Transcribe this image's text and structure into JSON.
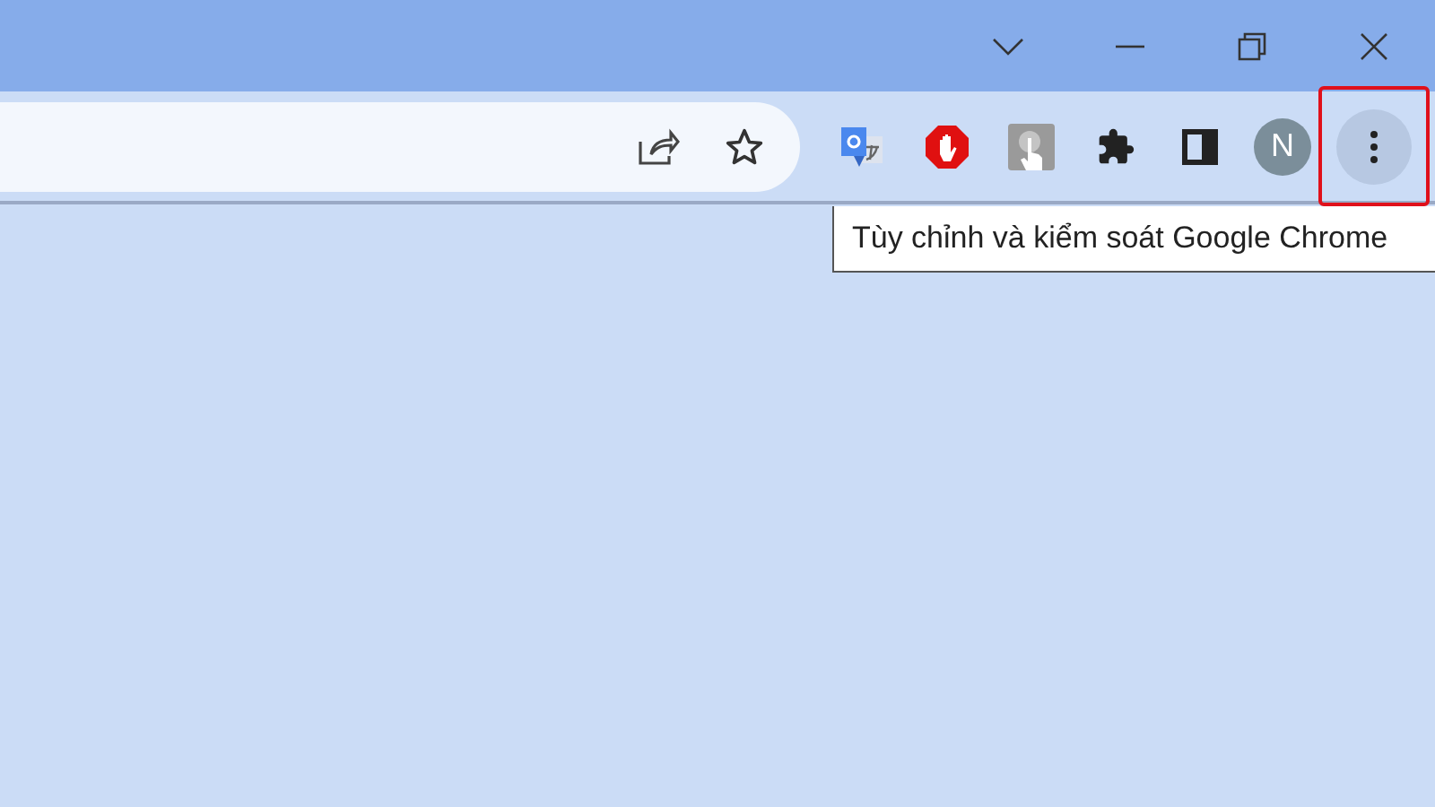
{
  "profile": {
    "initial": "N"
  },
  "menu_button": {
    "hovered": true,
    "highlighted": true
  },
  "tooltip": {
    "text": "Tùy chỉnh và kiểm soát Google Chrome"
  }
}
